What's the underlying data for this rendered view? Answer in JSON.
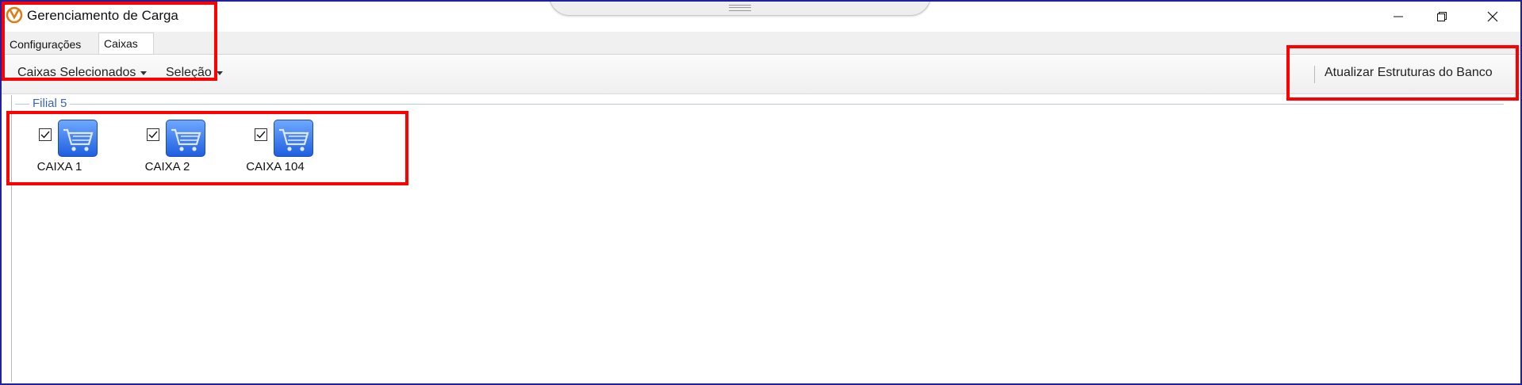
{
  "window": {
    "title": "Gerenciamento de Carga",
    "app_icon": "app-logo-icon",
    "controls": [
      "minimize-icon",
      "restore-icon",
      "close-icon"
    ]
  },
  "tabs": [
    {
      "label": "Configurações",
      "active": false
    },
    {
      "label": "Caixas",
      "active": true
    }
  ],
  "toolbar": {
    "caixas_selecionados": "Caixas Selecionados",
    "selecao": "Seleção",
    "atualizar": "Atualizar Estruturas do Banco"
  },
  "group": {
    "label": "Filial 5",
    "caixas": [
      {
        "label": "CAIXA 1",
        "checked": true,
        "icon": "shopping-cart-icon"
      },
      {
        "label": "CAIXA 2",
        "checked": true,
        "icon": "shopping-cart-icon"
      },
      {
        "label": "CAIXA 104",
        "checked": true,
        "icon": "shopping-cart-icon"
      }
    ]
  },
  "colors": {
    "highlight": "#ff0000",
    "group_label": "#3a64b8",
    "cart_icon": "#2d6fe8",
    "window_border": "#2020a0"
  }
}
